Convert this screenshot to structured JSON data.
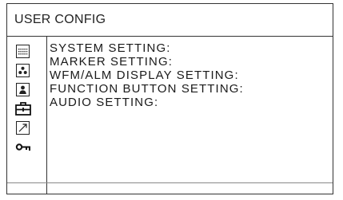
{
  "window": {
    "title": "USER CONFIG"
  },
  "sidebar": {
    "icons": [
      {
        "name": "system-icon"
      },
      {
        "name": "marker-icon"
      },
      {
        "name": "display-icon"
      },
      {
        "name": "function-button-icon",
        "selected": true
      },
      {
        "name": "audio-icon"
      },
      {
        "name": "key-icon"
      }
    ]
  },
  "menu": {
    "items": [
      {
        "label": "SYSTEM SETTING:"
      },
      {
        "label": "MARKER SETTING:"
      },
      {
        "label": "WFM/ALM DISPLAY SETTING:"
      },
      {
        "label": "FUNCTION BUTTON SETTING:"
      },
      {
        "label": "AUDIO SETTING:"
      }
    ]
  },
  "colors": {
    "line": "#333333",
    "text": "#1a1a1a",
    "background": "#ffffff"
  }
}
